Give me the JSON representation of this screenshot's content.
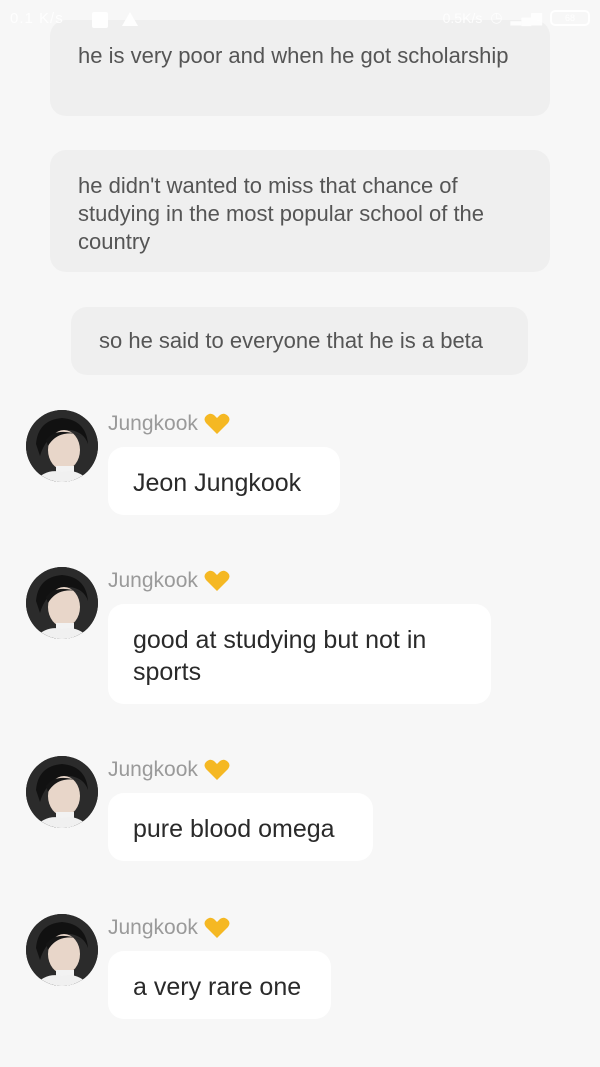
{
  "status_bar": {
    "left_text": "0.1 K/s",
    "right_text": "0.5K/s",
    "battery": "68"
  },
  "narration": [
    "he is very poor and when he got scholarship",
    "he didn't wanted to miss that chance of studying in the most popular school of the country",
    "so he said to everyone that he is a beta"
  ],
  "messages": [
    {
      "sender": "Jungkook",
      "text": "Jeon Jungkook"
    },
    {
      "sender": "Jungkook",
      "text": "good at studying but not in sports"
    },
    {
      "sender": "Jungkook",
      "text": "pure blood omega"
    },
    {
      "sender": "Jungkook",
      "text": "a very rare one"
    }
  ],
  "colors": {
    "background": "#f7f7f7",
    "narration_bubble": "#efefef",
    "message_bubble": "#ffffff",
    "heart": "#f5b823"
  },
  "icons": {
    "sender_badge": "yellow-heart-icon"
  }
}
